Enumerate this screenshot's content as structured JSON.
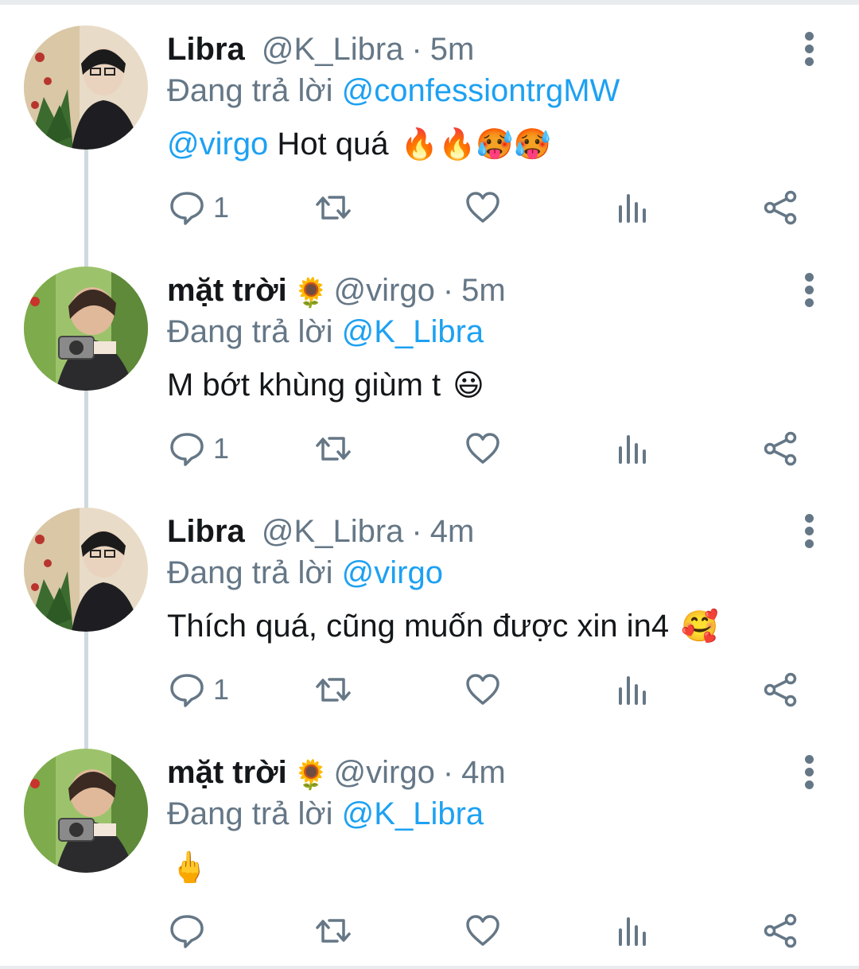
{
  "reply_prefix": "Đang trả lời",
  "tweets": [
    {
      "name": "Libra",
      "name_emoji": "",
      "handle": "@K_Libra",
      "time": "5m",
      "reply_to": "@confessiontrgMW",
      "text_mention": "@virgo",
      "text": " Hot quá ",
      "text_emoji": "🔥🔥🥵🥵",
      "reply_count": "1",
      "avatar": "libra-avatar"
    },
    {
      "name": "mặt trời",
      "name_emoji": "🌻",
      "handle": "@virgo",
      "time": "5m",
      "reply_to": "@K_Libra",
      "text_mention": "",
      "text": "M bớt khùng giùm t ",
      "text_emoji": "😃",
      "reply_count": "1",
      "avatar": "virgo-avatar"
    },
    {
      "name": "Libra",
      "name_emoji": "",
      "handle": "@K_Libra",
      "time": "4m",
      "reply_to": "@virgo",
      "text_mention": "",
      "text": "Thích quá, cũng muốn được xin in4 ",
      "text_emoji": "🥰",
      "reply_count": "1",
      "avatar": "libra-avatar"
    },
    {
      "name": "mặt trời",
      "name_emoji": "🌻",
      "handle": "@virgo",
      "time": "4m",
      "reply_to": "@K_Libra",
      "text_mention": "",
      "text": "",
      "text_emoji": "🖕",
      "reply_count": "",
      "avatar": "virgo-avatar"
    }
  ],
  "icons": {
    "reply": "comment-icon",
    "retweet": "retweet-icon",
    "like": "heart-icon",
    "stats": "analytics-icon",
    "share": "share-icon",
    "more": "more-vertical-icon"
  },
  "colors": {
    "link": "#1da1f2",
    "muted": "#657786",
    "text": "#14171a",
    "thread": "#cfd9de"
  }
}
